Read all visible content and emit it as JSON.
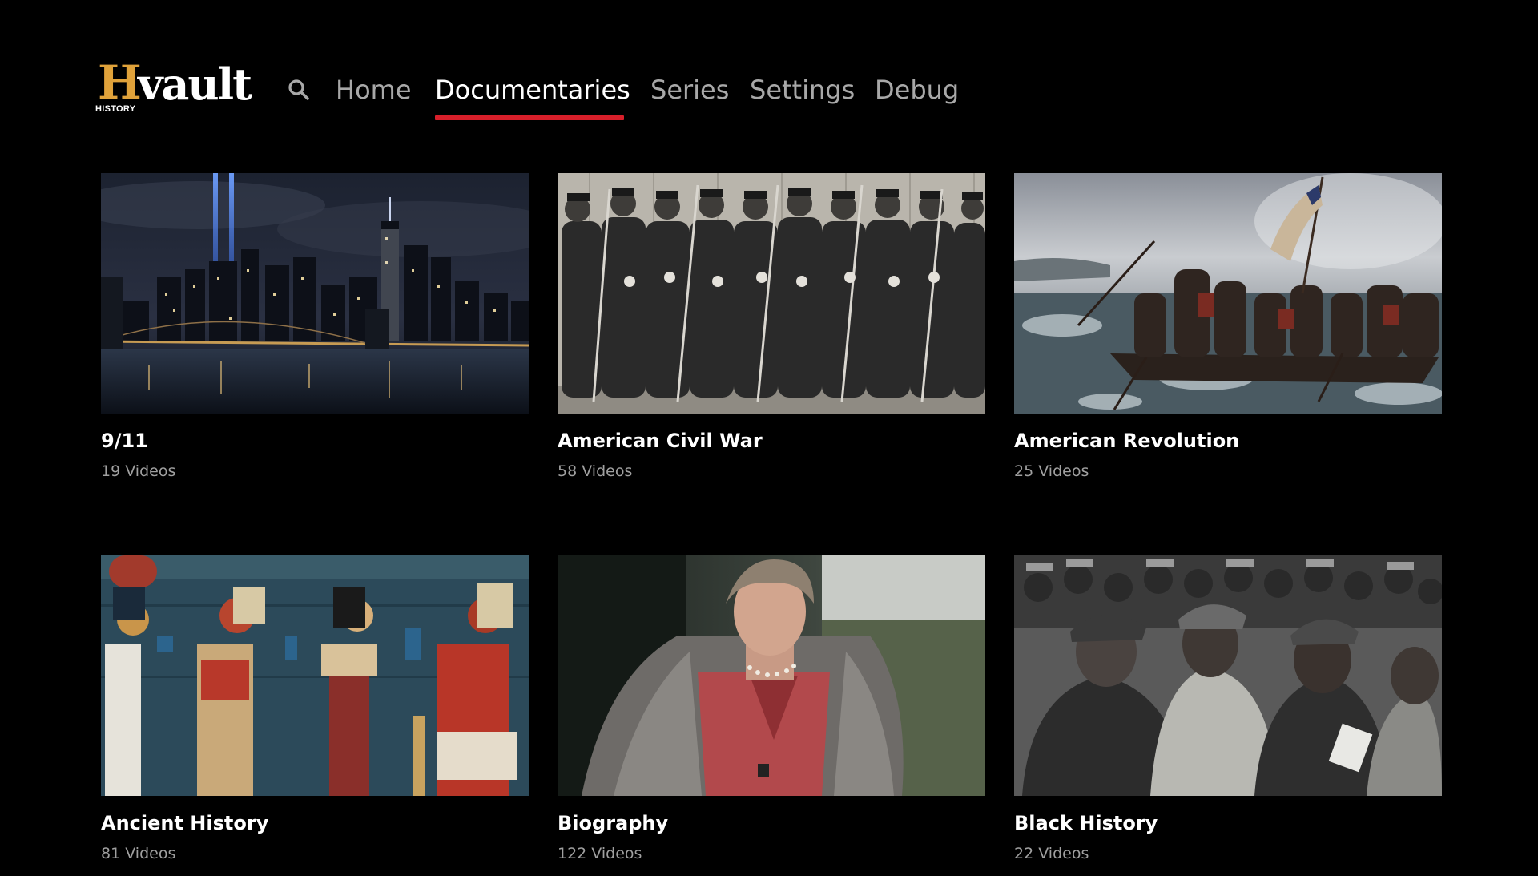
{
  "header": {
    "logo": {
      "mark": "H",
      "word": "vault",
      "brand": "HISTORY"
    },
    "search_icon": "search-icon",
    "nav": [
      {
        "label": "Home",
        "active": false
      },
      {
        "label": "Documentaries",
        "active": true
      },
      {
        "label": "Series",
        "active": false
      },
      {
        "label": "Settings",
        "active": false
      },
      {
        "label": "Debug",
        "active": false
      }
    ]
  },
  "colors": {
    "background": "#000000",
    "accent": "#d71f2a",
    "logo_gold": "#e0a23a",
    "nav_inactive": "#a8a8a8",
    "nav_active": "#ffffff",
    "subtitle": "#a0a0a0"
  },
  "categories": [
    {
      "title": "9/11",
      "count": "19 Videos",
      "thumbnail": "night-city-skyline-with-tribute-in-light-beams"
    },
    {
      "title": "American Civil War",
      "count": "58 Videos",
      "thumbnail": "black-and-white-photo-of-union-soldiers-with-rifles"
    },
    {
      "title": "American Revolution",
      "count": "25 Videos",
      "thumbnail": "painting-of-washington-crossing-the-delaware"
    },
    {
      "title": "Ancient History",
      "count": "81 Videos",
      "thumbnail": "egyptian-tomb-wall-painting"
    },
    {
      "title": "Biography",
      "count": "122 Videos",
      "thumbnail": "woman-in-fur-coat-and-pearls"
    },
    {
      "title": "Black History",
      "count": "22 Videos",
      "thumbnail": "black-and-white-photo-of-pilots-in-flight-jackets"
    }
  ]
}
